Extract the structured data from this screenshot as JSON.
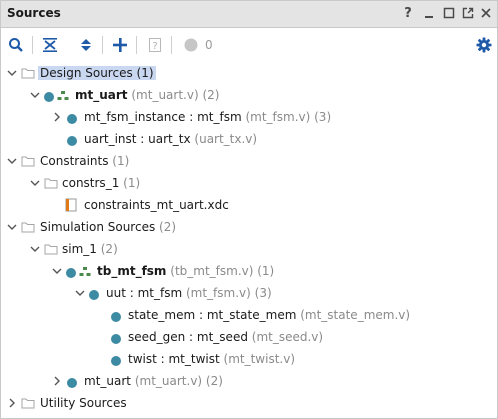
{
  "panel": {
    "title": "Sources",
    "help_label": "?",
    "warning_count": "0"
  },
  "tree": {
    "design_sources": {
      "label": "Design Sources",
      "count": "(1)"
    },
    "mt_uart": {
      "name": "mt_uart",
      "meta": "(mt_uart.v) (2)"
    },
    "mt_fsm_instance": {
      "name": "mt_fsm_instance : mt_fsm",
      "meta": "(mt_fsm.v) (3)"
    },
    "uart_inst": {
      "name": "uart_inst : uart_tx",
      "meta": "(uart_tx.v)"
    },
    "constraints": {
      "label": "Constraints",
      "count": "(1)"
    },
    "constrs_1": {
      "label": "constrs_1",
      "count": "(1)"
    },
    "xdc_file": {
      "name": "constraints_mt_uart.xdc"
    },
    "sim_sources": {
      "label": "Simulation Sources",
      "count": "(2)"
    },
    "sim_1": {
      "label": "sim_1",
      "count": "(2)"
    },
    "tb_mt_fsm": {
      "name": "tb_mt_fsm",
      "meta": "(tb_mt_fsm.v) (1)"
    },
    "uut": {
      "name": "uut : mt_fsm",
      "meta": "(mt_fsm.v) (3)"
    },
    "state_mem": {
      "name": "state_mem : mt_state_mem",
      "meta": "(mt_state_mem.v)"
    },
    "seed_gen": {
      "name": "seed_gen : mt_seed",
      "meta": "(mt_seed.v)"
    },
    "twist": {
      "name": "twist : mt_twist",
      "meta": "(mt_twist.v)"
    },
    "sim_mt_uart": {
      "name": "mt_uart",
      "meta": "(mt_uart.v) (2)"
    },
    "utility_sources": {
      "label": "Utility Sources"
    }
  },
  "colors": {
    "accent": "#1e5aa8",
    "module_dot": "#3d8aa3",
    "selection": "#c9d8f0",
    "folder": "#b0b0b0"
  }
}
